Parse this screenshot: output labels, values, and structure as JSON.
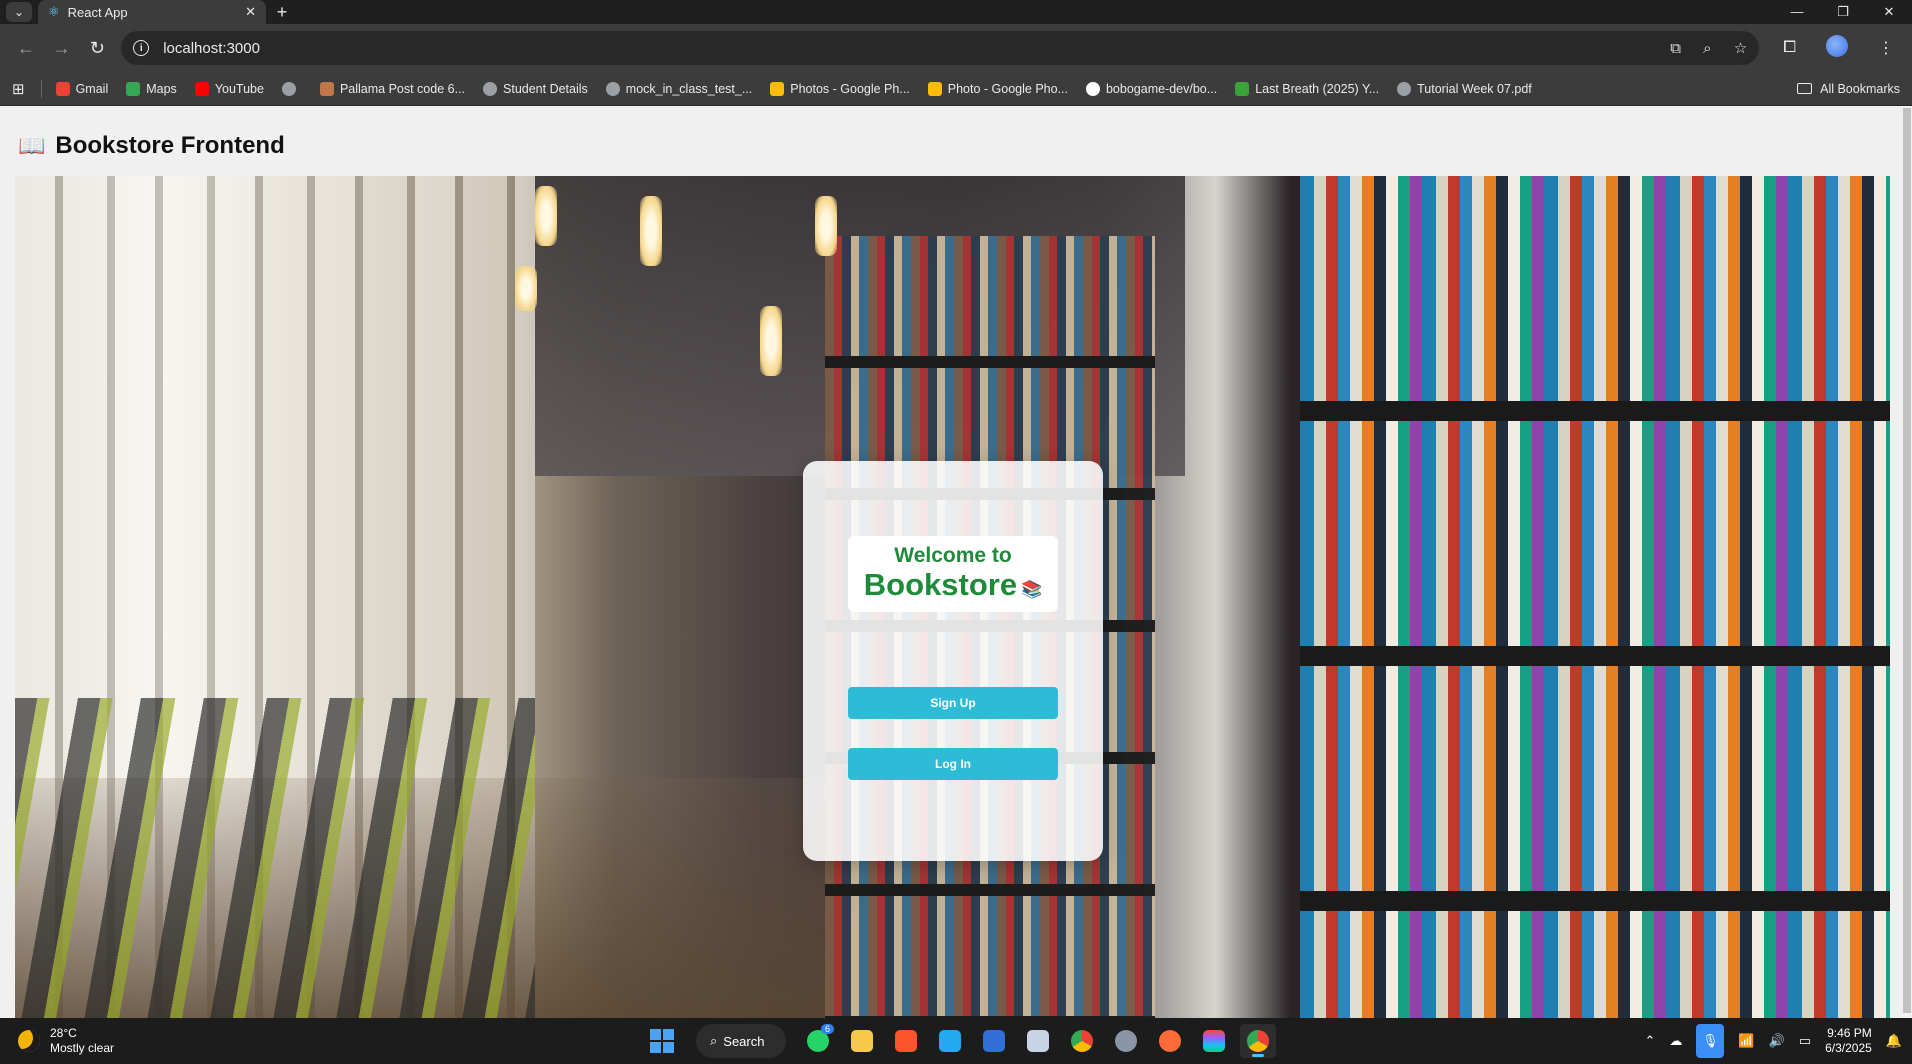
{
  "browser": {
    "tab_title": "React App",
    "url": "localhost:3000",
    "bookmarks": [
      {
        "label": "Gmail",
        "color": "#ea4335",
        "icon": "gmail-icon"
      },
      {
        "label": "Maps",
        "color": "#34a853",
        "icon": "maps-icon"
      },
      {
        "label": "YouTube",
        "color": "#ff0000",
        "icon": "youtube-icon"
      },
      {
        "label": "",
        "color": "#9aa0a6",
        "icon": "globe-icon"
      },
      {
        "label": "Pallama Post code 6...",
        "color": "#c0784a",
        "icon": "post-icon"
      },
      {
        "label": "Student Details",
        "color": "#9aa0a6",
        "icon": "globe-icon"
      },
      {
        "label": "mock_in_class_test_...",
        "color": "#9aa0a6",
        "icon": "globe-icon"
      },
      {
        "label": "Photos - Google Ph...",
        "color": "#fbbc05",
        "icon": "photos-icon"
      },
      {
        "label": "Photo - Google Pho...",
        "color": "#fbbc05",
        "icon": "photos-icon"
      },
      {
        "label": "bobogame-dev/bo...",
        "color": "#ffffff",
        "icon": "github-icon"
      },
      {
        "label": "Last Breath (2025) Y...",
        "color": "#3aa33a",
        "icon": "movie-icon"
      },
      {
        "label": "Tutorial Week 07.pdf",
        "color": "#9aa0a6",
        "icon": "globe-icon"
      }
    ],
    "all_bookmarks_label": "All Bookmarks"
  },
  "app": {
    "header_title": "Bookstore Frontend",
    "welcome_line1": "Welcome to",
    "welcome_line2": "Bookstore",
    "signup_label": "Sign Up",
    "login_label": "Log In",
    "accent_green": "#1f8b3a",
    "button_color": "#2ebbd6"
  },
  "taskbar": {
    "temperature": "28°C",
    "weather": "Mostly clear",
    "search_label": "Search",
    "whatsapp_badge": "6",
    "time": "9:46 PM",
    "date": "6/3/2025"
  }
}
